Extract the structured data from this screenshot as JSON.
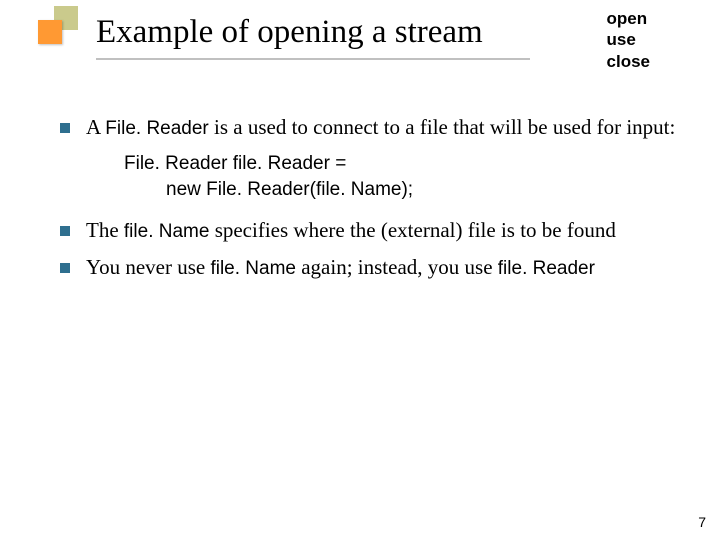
{
  "title": "Example of opening a stream",
  "corner": [
    "open",
    "use",
    "close"
  ],
  "bullets": [
    {
      "runs": [
        "A ",
        "File. Reader",
        " is a used to connect to a file that will be used for input:"
      ]
    },
    {
      "runs": [
        "The ",
        "file. Name",
        " specifies where the (external) file is to be found"
      ]
    },
    {
      "runs": [
        "You never use ",
        "file. Name",
        " again; instead, you use ",
        "file. Reader"
      ]
    }
  ],
  "code": {
    "line1": "File. Reader file. Reader =",
    "line2": "new File. Reader(file. Name);"
  },
  "page": "7"
}
